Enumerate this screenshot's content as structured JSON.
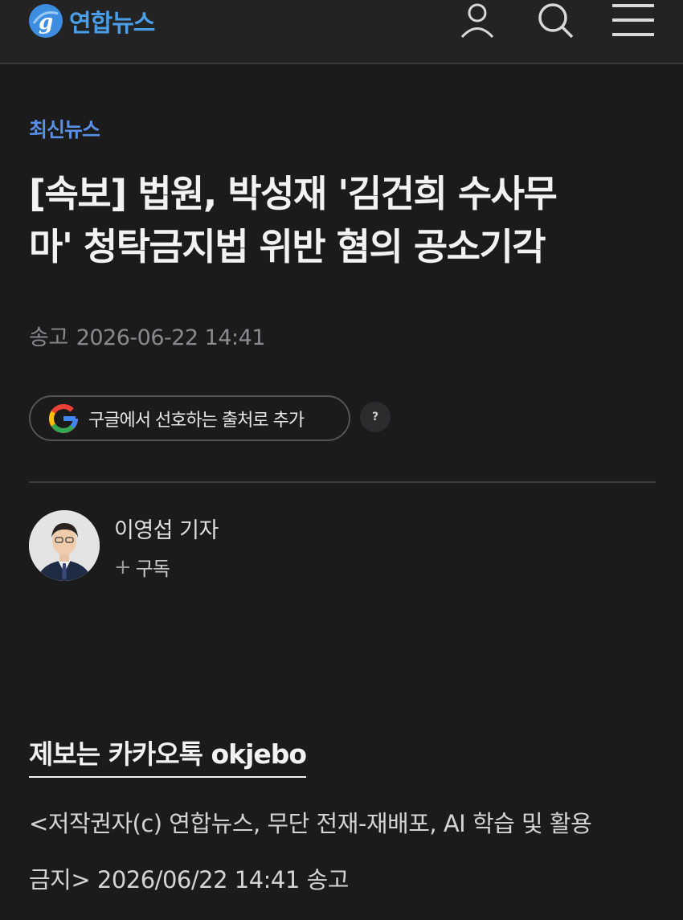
{
  "header": {
    "logo_text": "연합뉴스",
    "icons": [
      "user-icon",
      "search-icon",
      "menu-icon"
    ],
    "brand_color": "#4a9de8"
  },
  "article": {
    "category": "최신뉴스",
    "headline_line1": "[속보] 법원, 박성재 '김건희 수사무",
    "headline_line2": "마' 청탁금지법 위반 혐의 공소기각",
    "dateline_label": "송고",
    "dateline_time": "2026-06-22 14:41",
    "google_button_label": "구글에서 선호하는 출처로 추가",
    "help_label": "?",
    "reporter_name": "이영섭 기자",
    "subscribe_label": "구독",
    "tip_text": "제보는 카카오톡 okjebo",
    "copyright_line1": "<저작권자(c) 연합뉴스, 무단 전재-재배포, AI 학습 및 활용",
    "copyright_line2": "금지> 2026/06/22 14:41 송고"
  },
  "colors": {
    "background": "#1b1b1c",
    "category": "#5a8fe6"
  }
}
